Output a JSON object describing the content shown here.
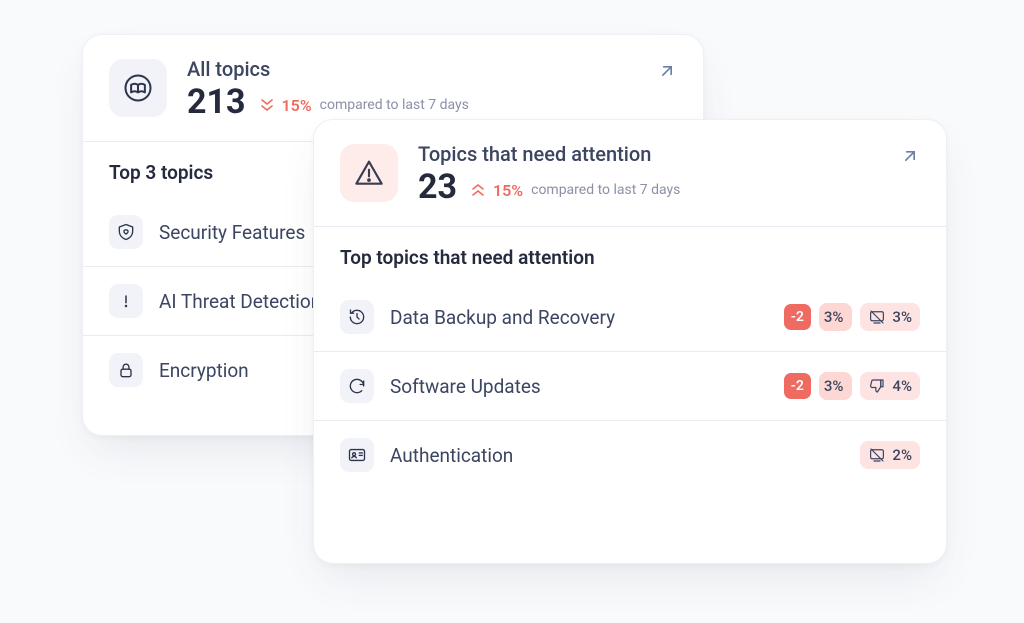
{
  "cardA": {
    "title": "All topics",
    "value": "213",
    "trend_dir": "down",
    "trend_pct": "15%",
    "trend_text": "compared to last 7 days",
    "section_title": "Top 3 topics",
    "rows": [
      {
        "icon": "shield-heart",
        "label": "Security Features"
      },
      {
        "icon": "alert-bar",
        "label": "AI Threat Detection"
      },
      {
        "icon": "lock",
        "label": "Encryption"
      }
    ]
  },
  "cardB": {
    "title": "Topics that need attention",
    "value": "23",
    "trend_dir": "up",
    "trend_pct": "15%",
    "trend_text": "compared to last 7 days",
    "section_title": "Top topics that need attention",
    "rows": [
      {
        "icon": "history",
        "label": "Data Backup and Recovery",
        "badges": [
          {
            "kind": "strong",
            "text": "-2"
          },
          {
            "kind": "soft",
            "text": "3%"
          },
          {
            "kind": "pink",
            "glyph": "no-screen",
            "text": "3%"
          }
        ]
      },
      {
        "icon": "refresh",
        "label": "Software Updates",
        "badges": [
          {
            "kind": "strong",
            "text": "-2"
          },
          {
            "kind": "soft",
            "text": "3%"
          },
          {
            "kind": "pink",
            "glyph": "thumb-down",
            "text": "4%"
          }
        ]
      },
      {
        "icon": "id-card",
        "label": "Authentication",
        "badges": [
          {
            "kind": "pink",
            "glyph": "no-screen",
            "text": "2%"
          }
        ]
      }
    ]
  }
}
